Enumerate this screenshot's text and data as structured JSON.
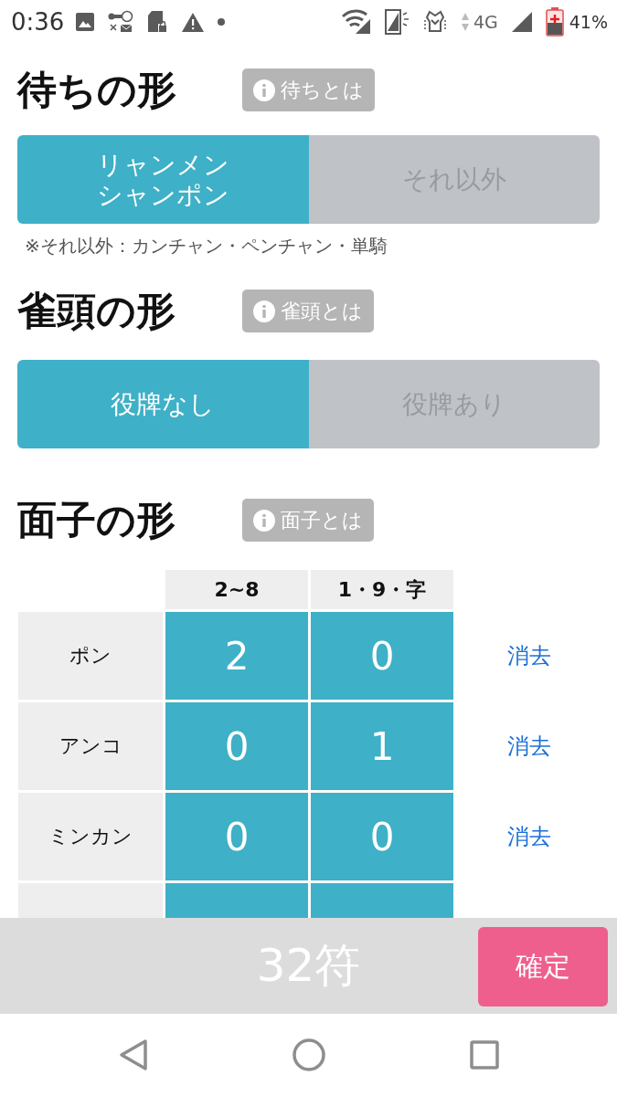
{
  "status_bar": {
    "time": "0:36",
    "network": "4G",
    "battery": "41%"
  },
  "sections": [
    {
      "title": "待ちの形",
      "info": "待ちとは",
      "options": [
        {
          "label": "リャンメンシャンポン",
          "selected": true
        },
        {
          "label": "それ以外",
          "selected": false
        }
      ],
      "note": "※それ以外：カンチャン・ペンチャン・単騎"
    },
    {
      "title": "雀頭の形",
      "info": "雀頭とは",
      "options": [
        {
          "label": "役牌なし",
          "selected": true
        },
        {
          "label": "役牌あり",
          "selected": false
        }
      ]
    }
  ],
  "mentsu": {
    "title": "面子の形",
    "info": "面子とは",
    "table": {
      "columns": [
        "2~8",
        "1・9・字"
      ],
      "rows": [
        {
          "label": "ポン",
          "values": [
            "2",
            "0"
          ],
          "action": "消去"
        },
        {
          "label": "アンコ",
          "values": [
            "0",
            "1"
          ],
          "action": "消去"
        },
        {
          "label": "ミンカン",
          "values": [
            "0",
            "0"
          ],
          "action": "消去"
        }
      ],
      "partial_row": true
    }
  },
  "footer": {
    "total": "32符",
    "confirm": "確定"
  }
}
